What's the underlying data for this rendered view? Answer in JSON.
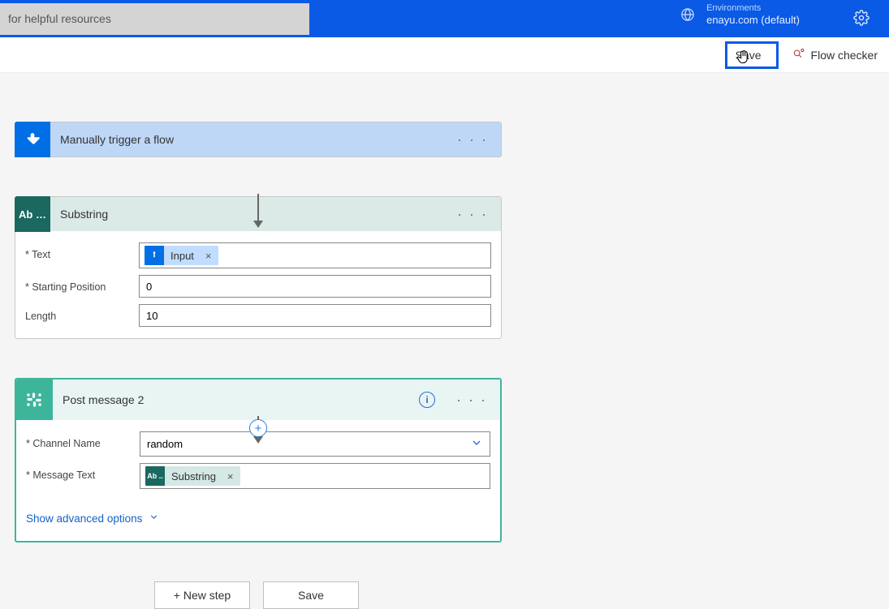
{
  "header": {
    "search_text": "for helpful resources",
    "env_label": "Environments",
    "env_value": "enayu.com (default)"
  },
  "toolbar": {
    "save_label": "Save",
    "checker_label": "Flow checker"
  },
  "trigger": {
    "title": "Manually trigger a flow"
  },
  "substring": {
    "title": "Substring",
    "icon_label": "Ab …",
    "fields": {
      "text": {
        "label": "* Text",
        "token_label": "Input"
      },
      "start": {
        "label": "* Starting Position",
        "value": "0"
      },
      "length": {
        "label": "Length",
        "value": "10"
      }
    }
  },
  "post": {
    "title": "Post message 2",
    "fields": {
      "channel": {
        "label": "* Channel Name",
        "value": "random"
      },
      "message": {
        "label": "* Message Text",
        "token_icon": "Ab ..",
        "token_label": "Substring"
      }
    },
    "advanced_link": "Show advanced options"
  },
  "buttons": {
    "new_step": "+ New step",
    "save": "Save"
  },
  "glyphs": {
    "close": "×",
    "info": "i",
    "plus": "+"
  }
}
